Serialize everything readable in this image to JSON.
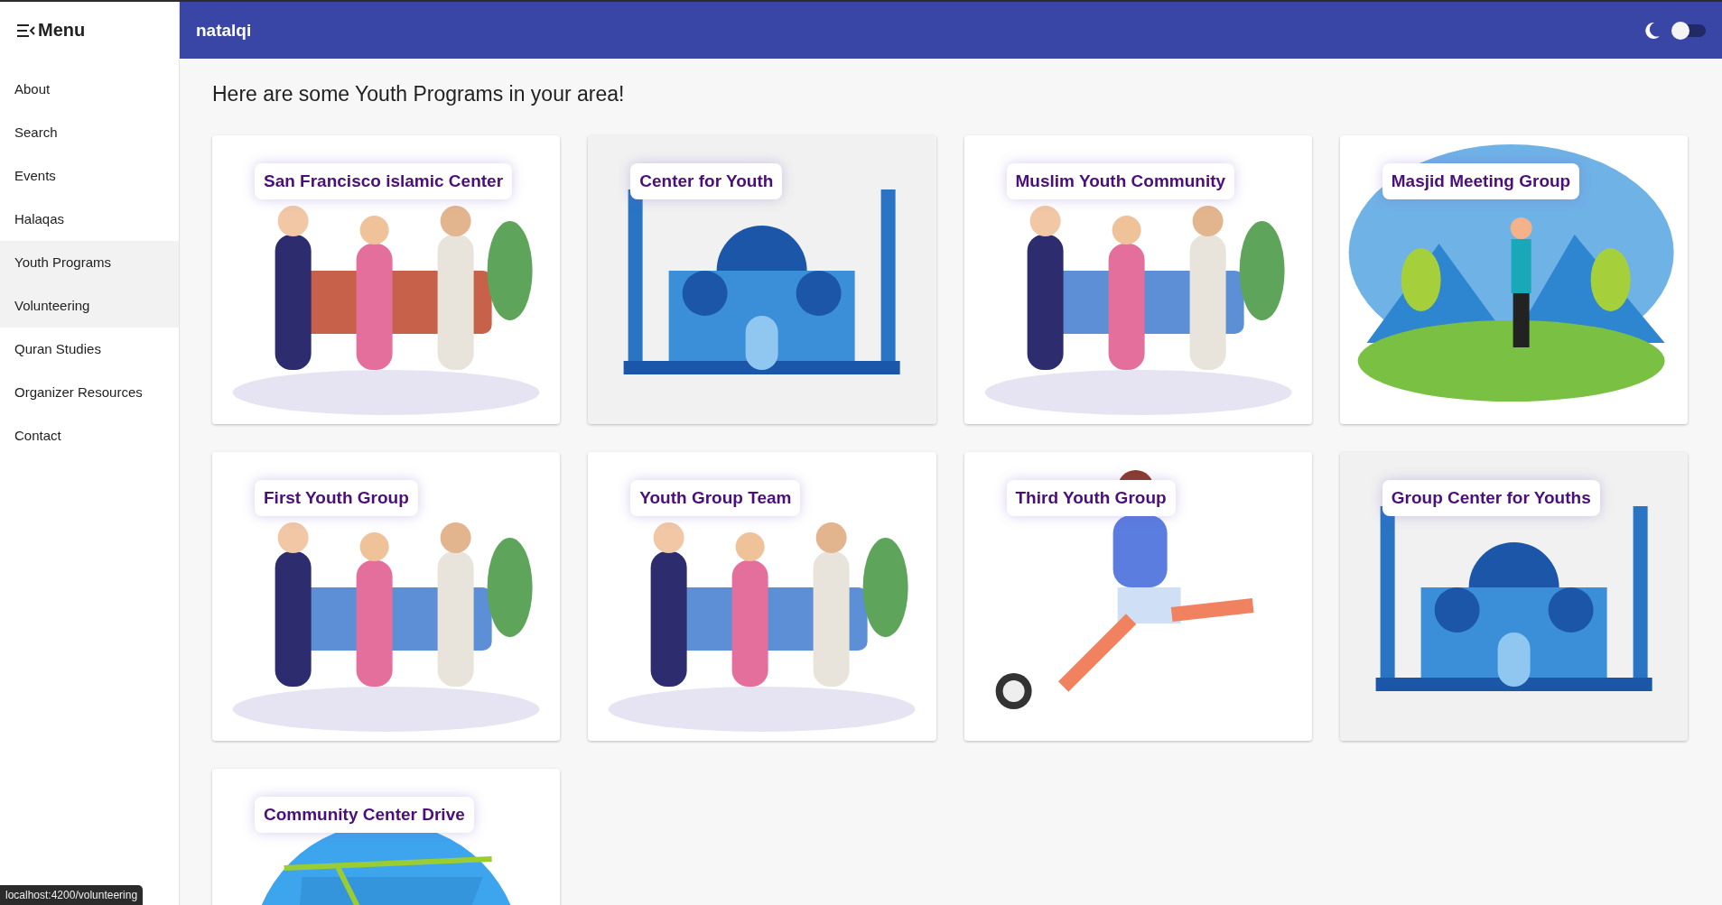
{
  "sidebar": {
    "title": "Menu",
    "items": [
      {
        "label": "About",
        "selected": false
      },
      {
        "label": "Search",
        "selected": false
      },
      {
        "label": "Events",
        "selected": false
      },
      {
        "label": "Halaqas",
        "selected": false
      },
      {
        "label": "Youth Programs",
        "selected": true
      },
      {
        "label": "Volunteering",
        "selected": true
      },
      {
        "label": "Quran Studies",
        "selected": false
      },
      {
        "label": "Organizer Resources",
        "selected": false
      },
      {
        "label": "Contact",
        "selected": false
      }
    ]
  },
  "toolbar": {
    "title": "natalqi",
    "dark_mode": {
      "on": false
    }
  },
  "heading": "Here are some Youth Programs in your area!",
  "cards": [
    {
      "title": "San Francisco islamic Center",
      "kind": "reading"
    },
    {
      "title": "Center for Youth",
      "kind": "mosque"
    },
    {
      "title": "Muslim Youth Community",
      "kind": "people"
    },
    {
      "title": "Masjid Meeting Group",
      "kind": "landscape"
    },
    {
      "title": "First Youth Group",
      "kind": "people"
    },
    {
      "title": "Youth Group Team",
      "kind": "classroom"
    },
    {
      "title": "Third Youth Group",
      "kind": "sport"
    },
    {
      "title": "Group Center for Youths",
      "kind": "mosque"
    },
    {
      "title": "Community Center Drive",
      "kind": "globe"
    }
  ],
  "status_bar": {
    "url": "localhost:4200/volunteering"
  }
}
